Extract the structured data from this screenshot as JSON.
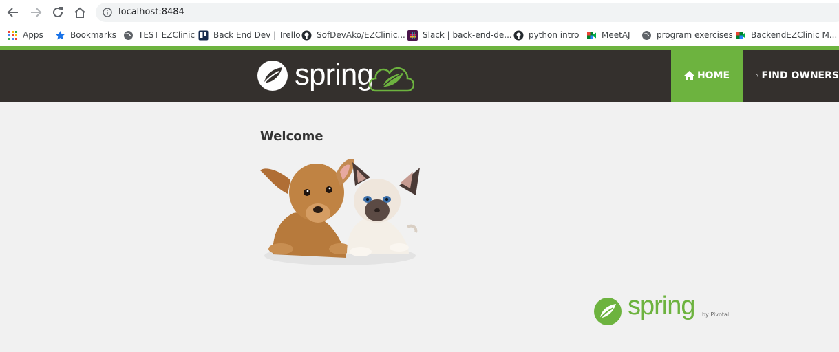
{
  "browser": {
    "url": "localhost:8484"
  },
  "bookmarks": [
    {
      "label": "Apps",
      "icon": "apps-grid-icon"
    },
    {
      "label": "Bookmarks",
      "icon": "star-icon"
    },
    {
      "label": "TEST EZClinic",
      "icon": "globe-icon"
    },
    {
      "label": "Back End Dev | Trello",
      "icon": "trello-icon"
    },
    {
      "label": "SofDevAko/EZClinic...",
      "icon": "github-icon"
    },
    {
      "label": "Slack | back-end-de...",
      "icon": "slack-icon"
    },
    {
      "label": "python intro",
      "icon": "github-icon"
    },
    {
      "label": "MeetAJ",
      "icon": "meet-icon"
    },
    {
      "label": "program exercises",
      "icon": "globe-icon"
    },
    {
      "label": "BackendEZClinic M...",
      "icon": "meet-icon"
    }
  ],
  "header": {
    "logo_text": "spring",
    "nav": {
      "home": "HOME",
      "find_owners": "FIND OWNERS"
    }
  },
  "main": {
    "title": "Welcome"
  },
  "footer": {
    "logo_text": "spring",
    "byline": "by Pivotal."
  },
  "colors": {
    "spring_green": "#6db33f",
    "navbar": "#34302d",
    "background": "#f1f1f1"
  }
}
